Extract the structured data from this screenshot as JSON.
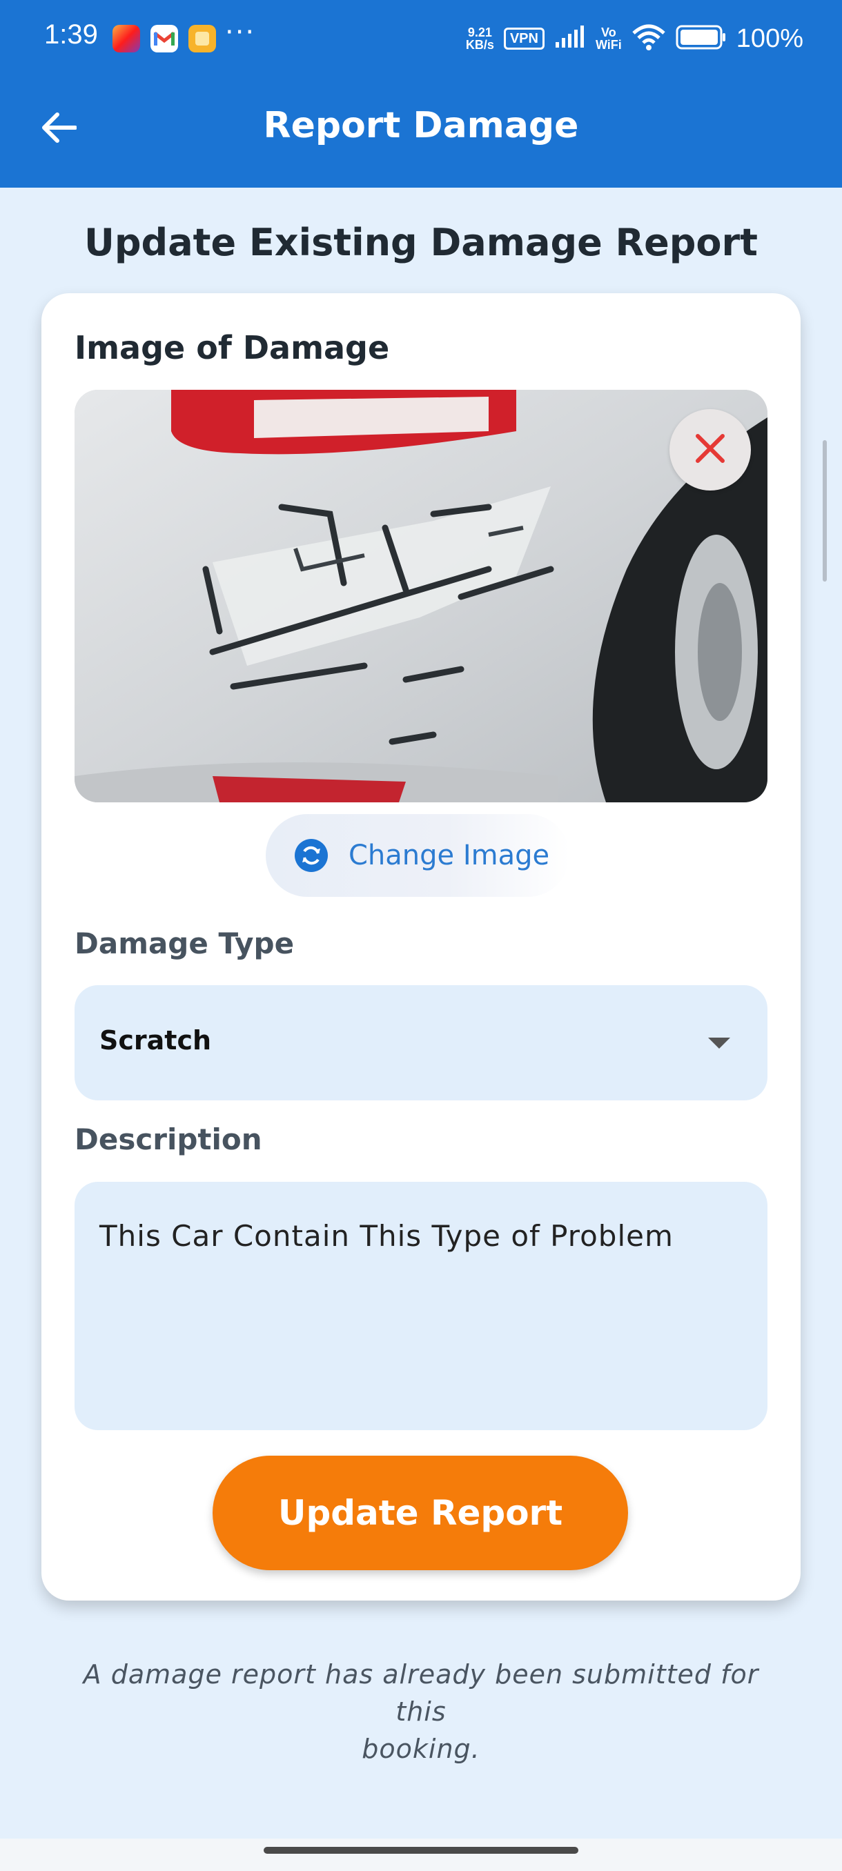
{
  "status_bar": {
    "time": "1:39",
    "network_speed_value": "9.21",
    "network_speed_unit": "KB/s",
    "vpn_label": "VPN",
    "vowifi_label_top": "Vo",
    "vowifi_label_bottom": "WiFi",
    "battery": "100%",
    "notification_icons": [
      "instagram-icon",
      "gmail-icon",
      "notes-icon"
    ],
    "more_glyph": "···"
  },
  "app_bar": {
    "title": "Report Damage",
    "back_icon": "arrow-left-icon"
  },
  "page": {
    "heading": "Update  Existing Damage Report"
  },
  "form": {
    "image_label": "Image of Damage",
    "change_image_label": "Change Image",
    "damage_type_label": "Damage Type",
    "damage_type_value": "Scratch",
    "description_label": "Description",
    "description_value": "This Car Contain This Type of Problem",
    "submit_label": "Update Report"
  },
  "footer": {
    "note_line1": "A damage report has already been submitted for this",
    "note_line2": "booking."
  },
  "colors": {
    "app_bar": "#1b74d3",
    "background": "#e4f0fc",
    "accent_button": "#f57c0a",
    "field_fill": "#e1eefb",
    "close_icon": "#e53935"
  }
}
